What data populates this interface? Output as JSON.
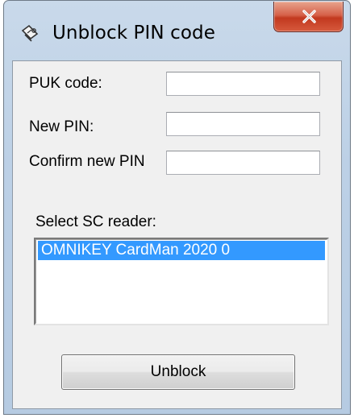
{
  "window": {
    "title": "Unblock PIN code",
    "icon": "smartcard-key-icon",
    "close_icon": "close-icon"
  },
  "form": {
    "puk_label": "PUK code:",
    "puk_value": "",
    "new_pin_label": "New PIN:",
    "new_pin_value": "",
    "confirm_pin_label": "Confirm new PIN",
    "confirm_pin_value": ""
  },
  "reader": {
    "label": "Select SC reader:",
    "items": [
      {
        "label": "OMNIKEY CardMan 2020 0",
        "selected": true
      }
    ]
  },
  "actions": {
    "unblock_label": "Unblock"
  },
  "colors": {
    "selection": "#3399ff",
    "close_button": "#c2391f",
    "frame": "#bcd0e6",
    "client": "#f0f0f0"
  }
}
